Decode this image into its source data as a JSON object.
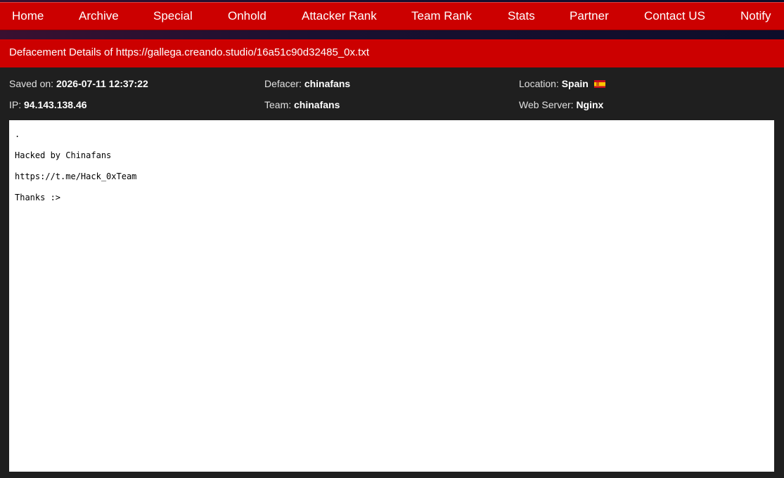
{
  "nav": {
    "items": [
      {
        "label": "Home"
      },
      {
        "label": "Archive"
      },
      {
        "label": "Special"
      },
      {
        "label": "Onhold"
      },
      {
        "label": "Attacker Rank"
      },
      {
        "label": "Team Rank"
      },
      {
        "label": "Stats"
      },
      {
        "label": "Partner"
      },
      {
        "label": "Contact US"
      },
      {
        "label": "Notify"
      }
    ]
  },
  "title": "Defacement Details of https://gallega.creando.studio/16a51c90d32485_0x.txt",
  "meta": {
    "saved_on_label": "Saved on:",
    "saved_on_value": "2026-07-11 12:37:22",
    "defacer_label": "Defacer:",
    "defacer_value": "chinafans",
    "location_label": "Location:",
    "location_value": "Spain",
    "ip_label": "IP:",
    "ip_value": "94.143.138.46",
    "team_label": "Team:",
    "team_value": "chinafans",
    "webserver_label": "Web Server:",
    "webserver_value": "Nginx",
    "flag_icon": "spain-flag-icon"
  },
  "content": {
    "lines": [
      ".",
      "Hacked by Chinafans",
      "https://t.me/Hack_0xTeam",
      "Thanks :>"
    ]
  },
  "colors": {
    "accent_red": "#cc0000",
    "background": "#1f1f1f",
    "content_bg": "#ffffff"
  }
}
